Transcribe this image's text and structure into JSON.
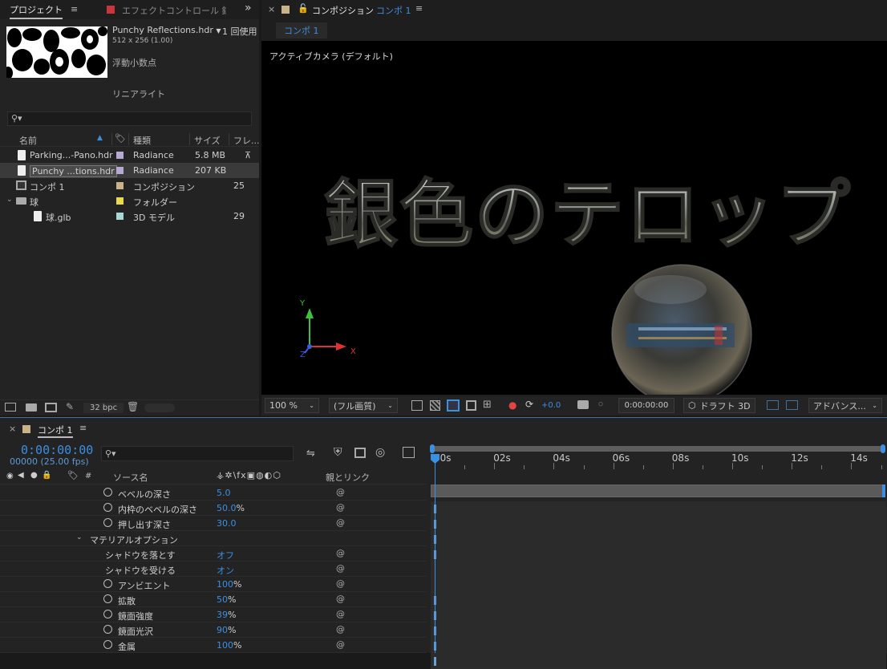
{
  "project_panel": {
    "tab_label": "プロジェクト",
    "effects_tab_label": "エフェクトコントロール 銀",
    "asset_name": "Punchy Reflections.hdr",
    "usage": "1 回使用",
    "dimensions": "512 x 256 (1.00)",
    "color_depth": "浮動小数点",
    "color_profile": "リニアライト",
    "search_placeholder": "",
    "columns": [
      "名前",
      "種類",
      "サイズ",
      "フレ..."
    ],
    "items": [
      {
        "name": "Parking...-Pano.hdr",
        "type": "Radiance",
        "size": "5.8 MB",
        "extra": "",
        "color": "#b7a9d1",
        "indent": 0
      },
      {
        "name": "Punchy ...tions.hdr",
        "type": "Radiance",
        "size": "207 KB",
        "extra": "",
        "color": "#b7a9d1",
        "indent": 0
      },
      {
        "name": "コンポ 1",
        "type": "コンポジション",
        "size": "",
        "extra": "25",
        "color": "#c9b48a",
        "indent": 0
      },
      {
        "name": "球",
        "type": "フォルダー",
        "size": "",
        "extra": "",
        "color": "#e8d94e",
        "indent": 0
      },
      {
        "name": "球.glb",
        "type": "3D モデル",
        "size": "",
        "extra": "29",
        "color": "#a7d8d5",
        "indent": 1
      }
    ],
    "bpc": "32 bpc"
  },
  "composition_panel": {
    "tab_label": "コンポジション",
    "tab_comp": "コンポ 1",
    "breadcrumb": "コンポ 1",
    "camera_label": "アクティブカメラ (デフォルト)",
    "telop_text": "銀色のテロップ",
    "axis_x": "X",
    "axis_y": "Y",
    "axis_z": "Z",
    "zoom": "100 %",
    "quality": "(フル画質)",
    "exposure": "+0.0",
    "timecode": "0:00:00:00",
    "draft3d": "ドラフト 3D",
    "renderer": "アドバンス..."
  },
  "timeline_panel": {
    "tab_label": "コンポ 1",
    "timecode": "0:00:00:00",
    "frames": "00000 (25.00 fps)",
    "search_placeholder": "",
    "col_hash": "#",
    "col_source": "ソース名",
    "col_parent": "親とリンク",
    "ruler": [
      "00s",
      "02s",
      "04s",
      "06s",
      "08s",
      "10s",
      "12s",
      "14s"
    ],
    "props": [
      {
        "label": "ベベルの深さ",
        "value": "5.0",
        "unit": "",
        "stopwatch": true,
        "indent": 2,
        "kf": true
      },
      {
        "label": "内枠のベベルの深さ",
        "value": "50.0",
        "unit": "%",
        "stopwatch": true,
        "indent": 2,
        "kf": true
      },
      {
        "label": "押し出す深さ",
        "value": "30.0",
        "unit": "",
        "stopwatch": true,
        "indent": 2,
        "kf": true
      },
      {
        "label": "マテリアルオプション",
        "value": "",
        "unit": "",
        "stopwatch": false,
        "indent": 1,
        "kf": true,
        "group": true
      },
      {
        "label": "シャドウを落とす",
        "value": "オフ",
        "unit": "",
        "stopwatch": false,
        "indent": 2,
        "kf": false
      },
      {
        "label": "シャドウを受ける",
        "value": "オン",
        "unit": "",
        "stopwatch": false,
        "indent": 2,
        "kf": false
      },
      {
        "label": "アンビエント",
        "value": "100",
        "unit": "%",
        "stopwatch": true,
        "indent": 2,
        "kf": true
      },
      {
        "label": "拡散",
        "value": "50",
        "unit": "%",
        "stopwatch": true,
        "indent": 2,
        "kf": true
      },
      {
        "label": "鏡面強度",
        "value": "39",
        "unit": "%",
        "stopwatch": true,
        "indent": 2,
        "kf": true
      },
      {
        "label": "鏡面光沢",
        "value": "90",
        "unit": "%",
        "stopwatch": true,
        "indent": 2,
        "kf": true
      },
      {
        "label": "金属",
        "value": "100",
        "unit": "%",
        "stopwatch": true,
        "indent": 2,
        "kf": true
      }
    ]
  },
  "colors": {
    "accent": "#3d8fe0",
    "panel": "#232323",
    "comp_bg": "#000000"
  }
}
